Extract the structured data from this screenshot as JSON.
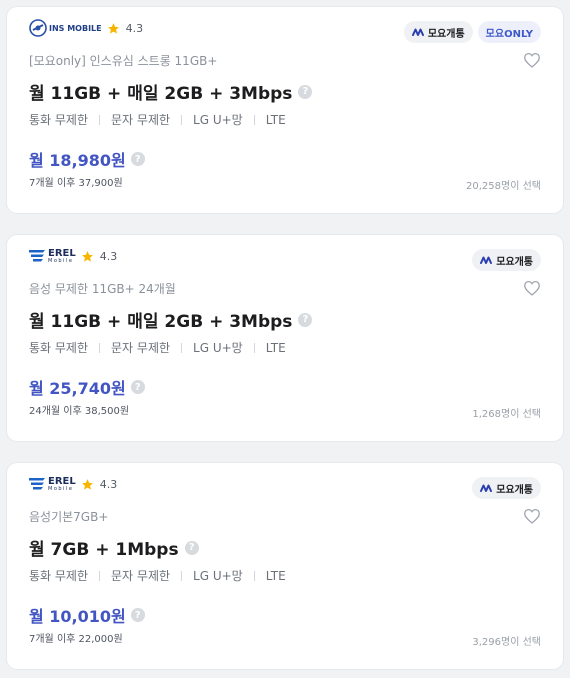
{
  "plans": [
    {
      "brand": {
        "logo": "INS MOBILE",
        "logo_icon": "ins-mobile-logo",
        "rating": "4.3"
      },
      "badges": [
        {
          "label": "모요개통",
          "icon": "moyo-icon",
          "type": "default"
        },
        {
          "label": "모요ONLY",
          "type": "only"
        }
      ],
      "subtitle": "[모요only] 인스유심 스트롱 11GB+",
      "title": "월 11GB + 매일 2GB + 3Mbps",
      "specs": [
        "통화 무제한",
        "문자 무제한",
        "LG U+망",
        "LTE"
      ],
      "price": "월 18,980원",
      "after": "7개월 이후 37,900원",
      "count": "20,258명이 선택"
    },
    {
      "brand": {
        "logo": "EREL",
        "logo_sub": "Mobile",
        "logo_icon": "erel-logo",
        "rating": "4.3"
      },
      "badges": [
        {
          "label": "모요개통",
          "icon": "moyo-icon",
          "type": "default"
        }
      ],
      "subtitle": "음성 무제한 11GB+ 24개월",
      "title": "월 11GB + 매일 2GB + 3Mbps",
      "specs": [
        "통화 무제한",
        "문자 무제한",
        "LG U+망",
        "LTE"
      ],
      "price": "월 25,740원",
      "after": "24개월 이후 38,500원",
      "count": "1,268명이 선택"
    },
    {
      "brand": {
        "logo": "EREL",
        "logo_sub": "Mobile",
        "logo_icon": "erel-logo",
        "rating": "4.3"
      },
      "badges": [
        {
          "label": "모요개통",
          "icon": "moyo-icon",
          "type": "default"
        }
      ],
      "subtitle": "음성기본7GB+",
      "title": "월 7GB + 1Mbps",
      "specs": [
        "통화 무제한",
        "문자 무제한",
        "LG U+망",
        "LTE"
      ],
      "price": "월 10,010원",
      "after": "7개월 이후 22,000원",
      "count": "3,296명이 선택"
    }
  ],
  "help_glyph": "?",
  "colors": {
    "price": "#4255c3",
    "star": "#f7b500",
    "only_badge": "#3f58c9"
  }
}
